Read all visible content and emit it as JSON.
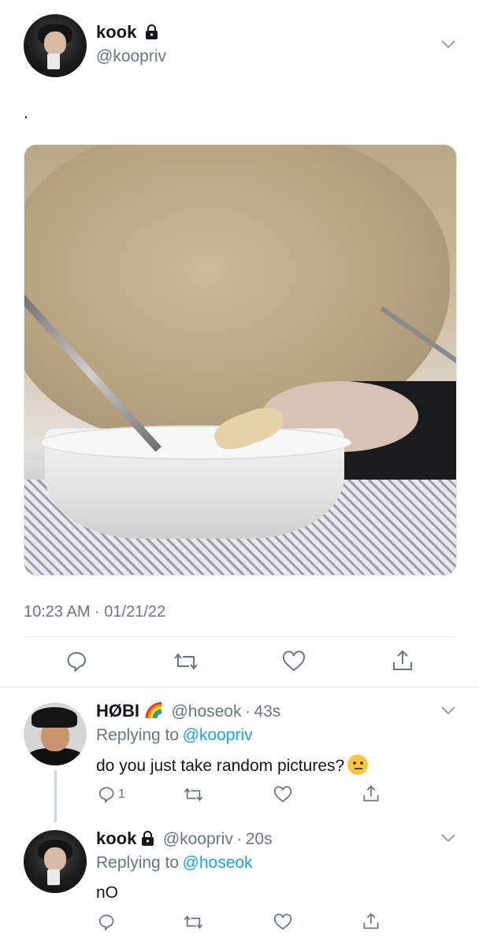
{
  "main_tweet": {
    "display_name": "kook",
    "handle": "@koopriv",
    "text": ".",
    "image_alt": "Photo of a person bent over a white bowl of noodles holding chopsticks",
    "timestamp": "10:23 AM · 01/21/22",
    "actions": {
      "reply": "reply-icon",
      "retweet": "retweet-icon",
      "like": "heart-icon",
      "share": "share-icon"
    }
  },
  "reply1": {
    "display_name": "HØBI",
    "handle": "@hoseok",
    "sep": "·",
    "time": "43s",
    "replying_prefix": "Replying to",
    "replying_to": "@koopriv",
    "text": "do you just take random pictures?",
    "reply_count": "1"
  },
  "reply2": {
    "display_name": "kook",
    "handle": "@koopriv",
    "sep": "·",
    "time": "20s",
    "replying_prefix": "Replying to",
    "replying_to": "@hoseok",
    "text": "nO"
  },
  "colors": {
    "accent": "#1da1f2",
    "secondary_text": "#657786",
    "divider": "#e1e8ed"
  }
}
